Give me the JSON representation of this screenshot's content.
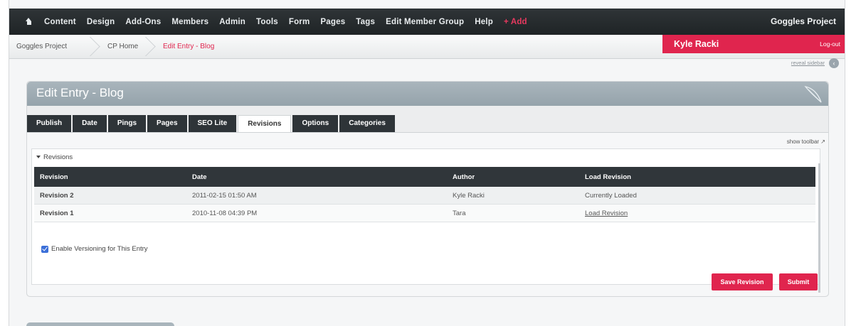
{
  "nav": {
    "items": [
      {
        "label": "Content"
      },
      {
        "label": "Design"
      },
      {
        "label": "Add-Ons"
      },
      {
        "label": "Members"
      },
      {
        "label": "Admin"
      },
      {
        "label": "Tools"
      },
      {
        "label": "Form"
      },
      {
        "label": "Pages"
      },
      {
        "label": "Tags"
      },
      {
        "label": "Edit Member Group"
      },
      {
        "label": "Help"
      }
    ],
    "add_label": "+ Add",
    "site_name": "Goggles Project",
    "home_icon": "home-icon"
  },
  "breadcrumb": {
    "items": [
      "Goggles Project",
      "CP Home",
      "Edit Entry - Blog"
    ]
  },
  "user": {
    "name": "Kyle Racki",
    "logout": "Log-out"
  },
  "sidebar": {
    "reveal_label": "reveal sidebar"
  },
  "panel": {
    "title": "Edit Entry - Blog",
    "tabs": [
      {
        "label": "Publish"
      },
      {
        "label": "Date"
      },
      {
        "label": "Pings"
      },
      {
        "label": "Pages"
      },
      {
        "label": "SEO Lite"
      },
      {
        "label": "Revisions"
      },
      {
        "label": "Options"
      },
      {
        "label": "Categories"
      }
    ],
    "active_tab": "Revisions",
    "show_toolbar": "show toolbar"
  },
  "revisions": {
    "section_label": "Revisions",
    "columns": [
      "Revision",
      "Date",
      "Author",
      "Load Revision"
    ],
    "rows": [
      {
        "revision": "Revision 2",
        "date": "2011-02-15 01:50 AM",
        "author": "Kyle Racki",
        "load": "Currently Loaded"
      },
      {
        "revision": "Revision 1",
        "date": "2010-11-08 04:39 PM",
        "author": "Tara",
        "load": "Load Revision"
      }
    ],
    "versioning_label": "Enable Versioning for This Entry",
    "versioning_checked": true
  },
  "actions": {
    "save_revision": "Save Revision",
    "submit": "Submit"
  },
  "colors": {
    "accent": "#e0254e",
    "nav_bg": "#2a2f32",
    "panel_header": "#9eabb3"
  }
}
